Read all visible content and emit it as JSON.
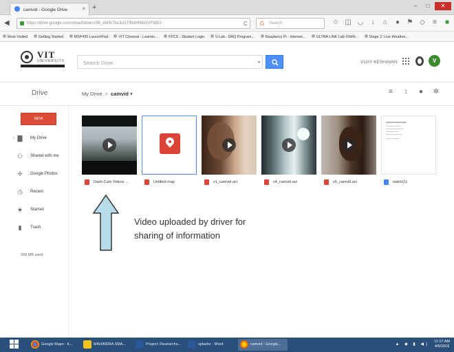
{
  "browser": {
    "tab_title": "camvid - Google Drive",
    "url": "https://drive.google.com/drive/folders/0B_k5Hx7bx3cGTlRdHNlbGVFWE0",
    "search_placeholder": "Search",
    "bookmarks": [
      "Most Visited",
      "Getting Started",
      "MSP430 LaunchPad",
      "VIT Chennai - Learnin...",
      "FFCS - Student Login",
      "V-Lab - DAQ Program...",
      "Raspberry Pi - Internet...",
      "ULTRA LINK Lab-VIWH...",
      "Stage 2: Live Weather..."
    ]
  },
  "logo": {
    "name": "VIT",
    "subtitle": "UNIVERSITY"
  },
  "drive": {
    "search_placeholder": "Search Drive",
    "user_name": "VIJAY KESHAVAN",
    "avatar_letter": "V",
    "title": "Drive",
    "breadcrumb_root": "My Drive",
    "breadcrumb_current": "camvid",
    "breadcrumb_sep": ">",
    "dropdown_caret": "▾"
  },
  "sidebar": {
    "new_label": "NEW",
    "items": [
      {
        "label": "My Drive",
        "icon": "folder-icon"
      },
      {
        "label": "Shared with me",
        "icon": "people-icon"
      },
      {
        "label": "Google Photos",
        "icon": "pinwheel-icon"
      },
      {
        "label": "Recent",
        "icon": "clock-icon"
      },
      {
        "label": "Starred",
        "icon": "star-icon"
      },
      {
        "label": "Trash",
        "icon": "trash-icon"
      }
    ],
    "storage": "308 MB used"
  },
  "files": [
    {
      "name": "Dash-Cam Videos ...",
      "type": "video"
    },
    {
      "name": "Untitled map",
      "type": "map"
    },
    {
      "name": "v1_camvid.avi",
      "type": "video"
    },
    {
      "name": "v4_camvid.avi",
      "type": "video"
    },
    {
      "name": "v5_camvid.avi",
      "type": "video"
    },
    {
      "name": "watch(1)",
      "type": "doc"
    }
  ],
  "annotation": {
    "line1": "Video uploaded by driver for",
    "line2": "sharing of information"
  },
  "taskbar": {
    "items": [
      "Google Maps - It...",
      "MAHINDRA SMA...",
      "Project: Researche...",
      "splashx - Word",
      "camvid - Google..."
    ],
    "tray": "▲ ◆ ▮ ◀)",
    "time": "11:17 AM",
    "date": "4/5/2016"
  },
  "colors": {
    "accent_blue": "#4d90fe",
    "new_red": "#dd4b39",
    "avatar_green": "#3c8a2e",
    "arrow_fill": "#b8dcea",
    "taskbar": "#2a4f7a"
  }
}
